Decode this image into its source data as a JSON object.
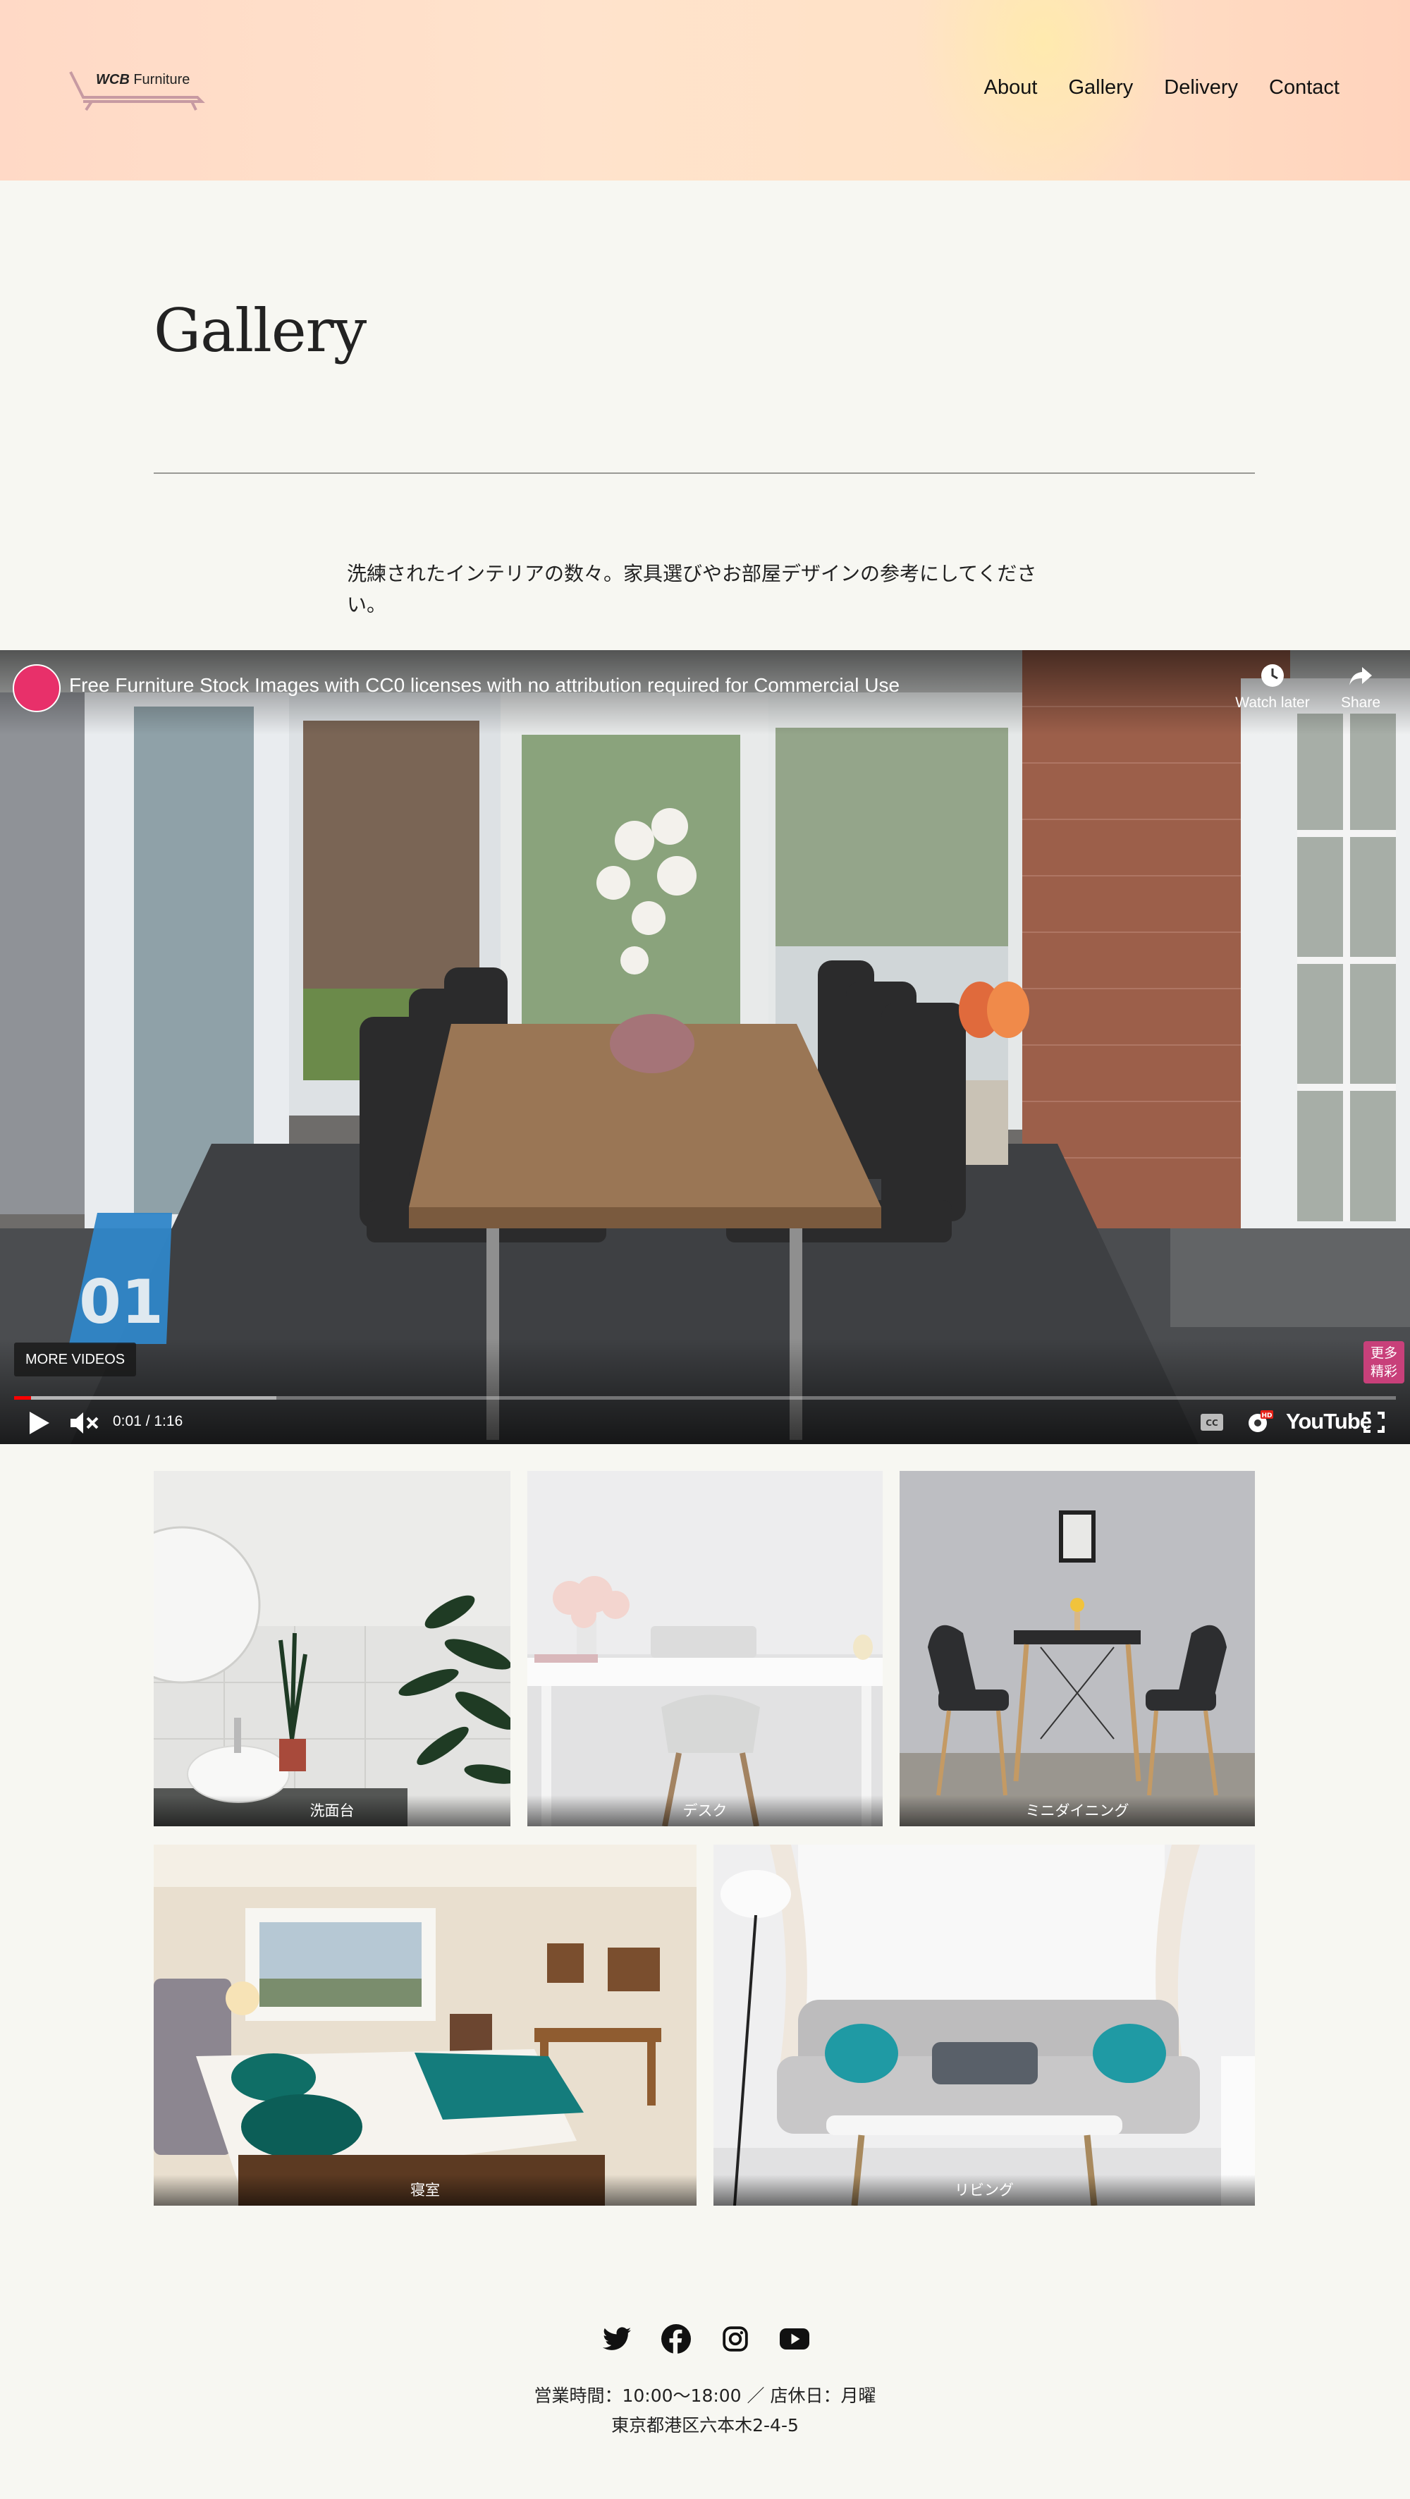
{
  "header": {
    "logo": {
      "brand_mark": "WCB",
      "brand_name": "Furniture"
    },
    "nav": [
      "About",
      "Gallery",
      "Delivery",
      "Contact"
    ]
  },
  "page": {
    "title": "Gallery",
    "intro": "洗練されたインテリアの数々。家具選びやお部屋デザインの参考にしてください。"
  },
  "video": {
    "title": "Free Furniture Stock Images with CC0 licenses with no attribution required for Commercial Use",
    "watch_later": "Watch later",
    "share": "Share",
    "badge_number": "01",
    "more_videos": "MORE VIDEOS",
    "more_clips": "更多\n精彩",
    "current_time": "0:01",
    "duration": "1:16",
    "time_display": "0:01 / 1:16",
    "progress_fraction": 0.012,
    "buffered_fraction": 0.19,
    "platform": "YouTube",
    "hd_badge": "HD"
  },
  "gallery": [
    {
      "caption": "洗面台"
    },
    {
      "caption": "デスク"
    },
    {
      "caption": "ミニダイニング"
    },
    {
      "caption": "寝室"
    },
    {
      "caption": "リビング"
    }
  ],
  "footer": {
    "social_icons": [
      "twitter-icon",
      "facebook-icon",
      "instagram-icon",
      "youtube-icon"
    ],
    "hours": "営業時間：10:00〜18:00 ／ 店休日：月曜",
    "address": "東京都港区六本木2-4-5"
  },
  "colors": {
    "background": "#f7f7f2",
    "header_gradient_start": "#ffd9c6",
    "header_gradient_end": "#ffd3bd",
    "progress_red": "#ff0000"
  }
}
